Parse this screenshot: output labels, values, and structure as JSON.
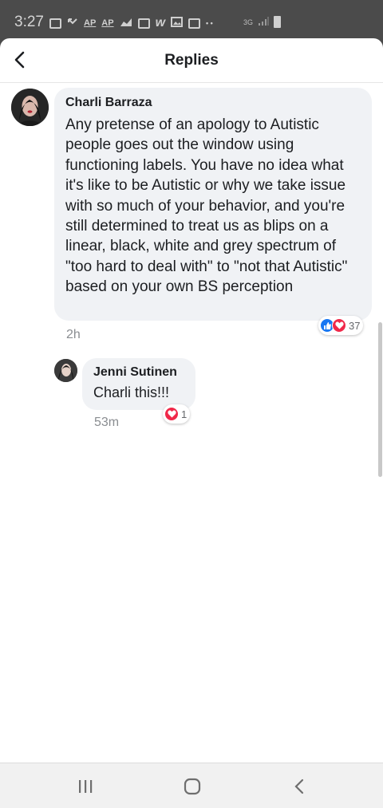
{
  "status_bar": {
    "time": "3:27",
    "icons": [
      "message-icon",
      "missed-call-icon",
      "ap-news-icon",
      "ap-news-icon",
      "stocks-icon",
      "notification-icon",
      "w-app-icon",
      "gallery-icon",
      "calendar-icon",
      "more-icon"
    ],
    "ap_label": "AP",
    "w_label": "w",
    "network": "3G",
    "more": "• •"
  },
  "header": {
    "title": "Replies",
    "back_icon": "chevron-left-icon"
  },
  "comments": [
    {
      "author": "Charli Barraza",
      "text": "Any pretense of an apology to Autistic people goes out the window using functioning labels. You have no idea what it's like to be Autistic or why we take issue with so much of your behavior, and you're still determined to treat us as blips on a linear, black, white and grey spectrum of \"too hard to deal with\" to \"not that Autistic\" based on your own BS perception",
      "time": "2h",
      "reactions": [
        "like",
        "love"
      ],
      "reaction_count": "37"
    }
  ],
  "replies": [
    {
      "author": "Jenni Sutinen",
      "text": "Charli this!!!",
      "time": "53m",
      "reactions": [
        "love"
      ],
      "reaction_count": "1"
    }
  ],
  "colors": {
    "bubble": "#f0f2f5",
    "like": "#1877f2",
    "love": "#f02849",
    "meta_text": "#8a8d91"
  },
  "nav": [
    "recent-apps-icon",
    "home-icon",
    "back-icon"
  ]
}
